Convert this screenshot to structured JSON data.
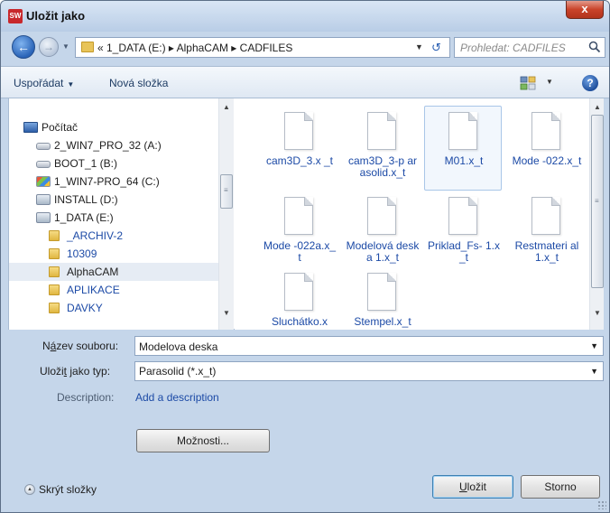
{
  "window": {
    "title": "Uložit jako",
    "app_icon_text": "SW",
    "close_glyph": "x"
  },
  "address": {
    "path": "« 1_DATA (E:) ▸ AlphaCAM ▸ CADFILES",
    "search_placeholder": "Prohledat: CADFILES"
  },
  "toolbar": {
    "organize_label": "Uspořádat",
    "new_folder_label": "Nová složka",
    "help_glyph": "?"
  },
  "nav_tree": {
    "items": [
      {
        "label": "Počítač",
        "icon": "computer-icon"
      },
      {
        "label": "2_WIN7_PRO_32 (A:)",
        "icon": "drive-icon"
      },
      {
        "label": "BOOT_1 (B:)",
        "icon": "drive-icon"
      },
      {
        "label": "1_WIN7-PRO_64 (C:)",
        "icon": "windows-drive-icon"
      },
      {
        "label": "INSTALL (D:)",
        "icon": "network-drive-icon"
      },
      {
        "label": "1_DATA (E:)",
        "icon": "network-drive-icon"
      },
      {
        "label": "_ARCHIV-2",
        "icon": "folder-icon"
      },
      {
        "label": "10309",
        "icon": "folder-icon"
      },
      {
        "label": "AlphaCAM",
        "icon": "folder-icon",
        "selected": true
      },
      {
        "label": "APLIKACE",
        "icon": "folder-icon"
      },
      {
        "label": "DAVKY",
        "icon": "folder-icon"
      }
    ]
  },
  "files": [
    {
      "name": "cam3D_3.x _t"
    },
    {
      "name": "cam3D_3-p arasolid.x_t"
    },
    {
      "name": "M01.x_t",
      "focused": true
    },
    {
      "name": "Mode -022.x_t"
    },
    {
      "name": "Mode -022a.x_t"
    },
    {
      "name": "Modelová deska 1.x_t"
    },
    {
      "name": "Priklad_Fs- 1.x_t"
    },
    {
      "name": "Restmateri al 1.x_t"
    },
    {
      "name": "Sluchátko.x"
    },
    {
      "name": "Stempel.x_t"
    }
  ],
  "form": {
    "filename_label_prefix": "N",
    "filename_label_underlined": "á",
    "filename_label_rest": "zev souboru:",
    "filename_value": "Modelova deska",
    "filetype_label_prefix": "Uloži",
    "filetype_label_underlined": "t",
    "filetype_label_rest": " jako typ:",
    "filetype_value": "Parasolid (*.x_t)",
    "description_label": "Description:",
    "description_link": "Add a description",
    "options_button": "Možnosti..."
  },
  "footer": {
    "hide_folders_label": "Skrýt složky",
    "save_button_underlined": "U",
    "save_button_rest": "ložit",
    "cancel_button": "Storno"
  },
  "colors": {
    "accent_link": "#1c4aa6",
    "window_frame": "#c5d6ea",
    "close_red": "#c9432a"
  }
}
